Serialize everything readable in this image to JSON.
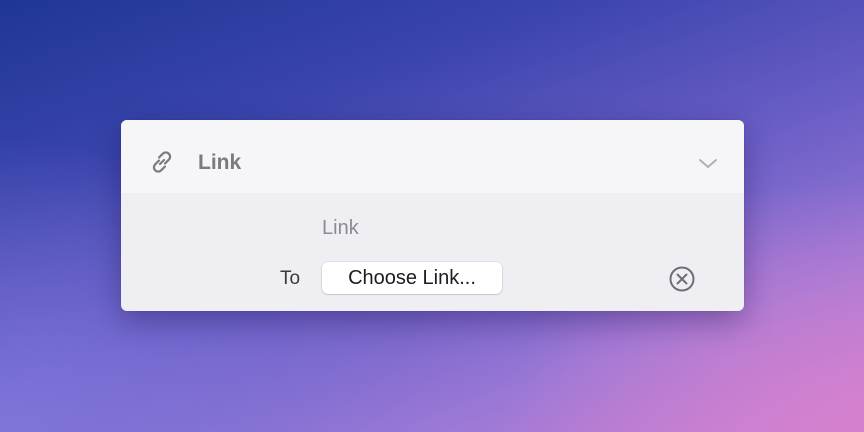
{
  "card": {
    "icon": "link-icon",
    "title": "Link",
    "expand_icon": "chevron-down-icon"
  },
  "parameter": {
    "name": "Link",
    "to_label": "To",
    "button_label": "Choose Link...",
    "clear_icon": "clear-circle-x-icon"
  },
  "colors": {
    "card_background": "#efeef3",
    "header_background": "#f6f6f9",
    "title_text": "#7a7a80",
    "button_background": "#ffffff"
  }
}
